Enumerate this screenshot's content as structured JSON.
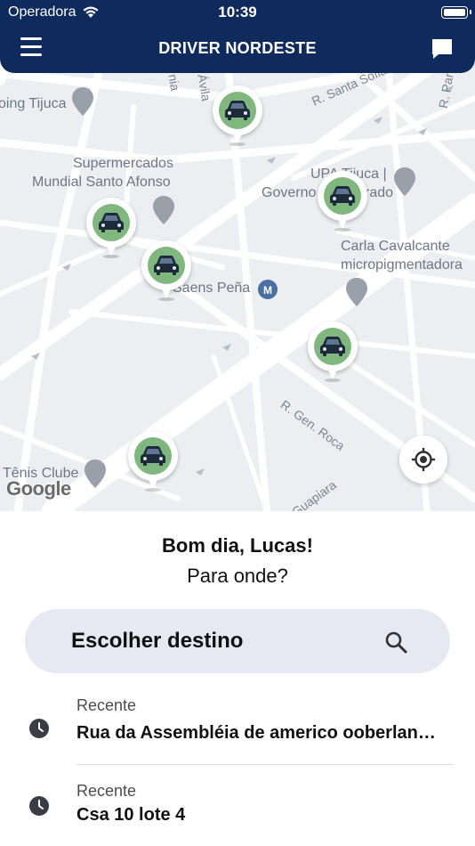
{
  "status_bar": {
    "carrier": "Operadora",
    "time": "10:39"
  },
  "header": {
    "title": "DRIVER NORDESTE"
  },
  "map": {
    "places": {
      "shopping_tijuca": "oing Tijuca",
      "supermercados_1": "Supermercados",
      "supermercados_2": "Mundial Santo Afonso",
      "upa_tijuca": "UPA Tijuca |",
      "governo": "Governo",
      "governo_suffix": "rado",
      "carla_1": "Carla Cavalcante",
      "carla_2": "micropigmentadora",
      "saens_pena": "Saens Peña",
      "tenis_clube": "Tênis Clube"
    },
    "streets": {
      "santa_sofia": "R. Santa Sofia",
      "gen_roca": "R. Gen. Roca",
      "guapiara": "Guapiara",
      "avila": "Ávila",
      "nia": "nia",
      "r_par": "R. Par"
    },
    "attribution": "Google",
    "car_icon": "car-icon",
    "pin_color": "#7fb77e"
  },
  "panel": {
    "greeting": "Bom dia, Lucas!",
    "question": "Para onde?",
    "search_label": "Escolher destino",
    "recents": [
      {
        "label": "Recente",
        "address": "Rua da Assembléia de americo ooberlan…"
      },
      {
        "label": "Recente",
        "address": "Csa 10 lote 4"
      }
    ]
  },
  "colors": {
    "brand": "#0f2a5c",
    "search_bg": "#e6e9f1"
  }
}
